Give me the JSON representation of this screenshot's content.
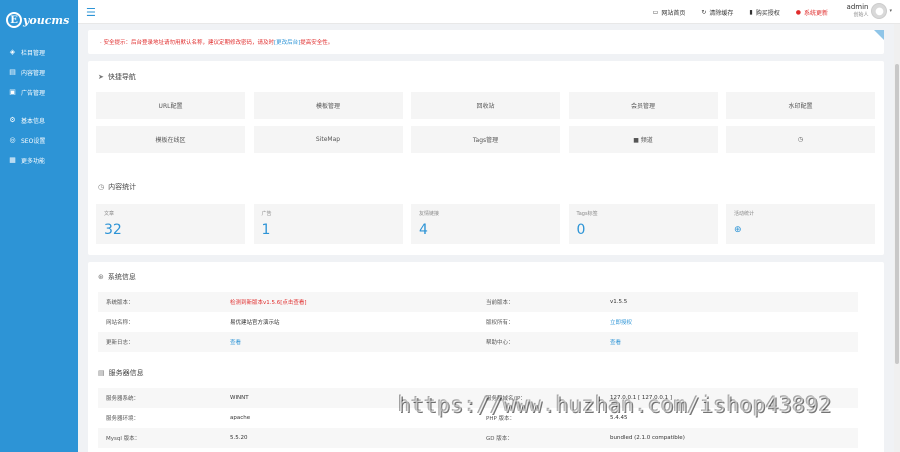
{
  "app": {
    "logo_letter": "E",
    "logo_text": "youcms"
  },
  "sidebar": {
    "items": [
      {
        "icon": "layers-icon",
        "glyph": "◈",
        "label": "栏目管理"
      },
      {
        "icon": "document-icon",
        "glyph": "▤",
        "label": "内容管理"
      },
      {
        "icon": "image-icon",
        "glyph": "▣",
        "label": "广告管理"
      },
      {
        "icon": "settings-icon",
        "glyph": "⚙",
        "label": "基本信息"
      },
      {
        "icon": "seo-icon",
        "glyph": "◎",
        "label": "SEO设置"
      },
      {
        "icon": "function-icon",
        "glyph": "▦",
        "label": "更多功能"
      }
    ]
  },
  "topbar": {
    "links": [
      {
        "glyph": "▭",
        "label": "网站首页"
      },
      {
        "glyph": "↻",
        "label": "清除缓存"
      },
      {
        "glyph": "▮",
        "label": "购买授权"
      },
      {
        "glyph": "●",
        "label": "系统更新"
      }
    ],
    "user": {
      "name": "admin",
      "role": "创始人",
      "caret": "▾"
    }
  },
  "alert": {
    "text": "· 安全提示：后台登录地址请勿用默认名称，建议定期修改密码，请及时",
    "link": "[更改后台]",
    "suffix": "提高安全性。"
  },
  "quick": {
    "title": "快捷导航",
    "icon_glyph": "➤",
    "items": [
      {
        "label": "URL配置"
      },
      {
        "label": "模板管理"
      },
      {
        "label": "回收站"
      },
      {
        "label": "会员管理"
      },
      {
        "label": "水印配置"
      },
      {
        "label": "模板在线区"
      },
      {
        "label": "SiteMap"
      },
      {
        "label": "Tags管理"
      },
      {
        "label": "■ 频道"
      },
      {
        "label": "◷"
      }
    ]
  },
  "stats": {
    "title": "内容统计",
    "icon_glyph": "◷",
    "items": [
      {
        "label": "文章",
        "value": "32"
      },
      {
        "label": "广告",
        "value": "1"
      },
      {
        "label": "友情链接",
        "value": "4"
      },
      {
        "label": "Tags标签",
        "value": "0"
      },
      {
        "label": "活动统计",
        "value": ""
      }
    ],
    "last_icon_glyph": "⊕"
  },
  "system": {
    "title": "系统信息",
    "icon_glyph": "⊛",
    "rows": [
      {
        "k1": "系统版本：",
        "v1": "检测到新版本v1.5.6[点击查看]",
        "k2": "当前版本：",
        "v2": "v1.5.5"
      },
      {
        "k1": "网站名称：",
        "v1": "易优建站官方演示站",
        "k2": "版权所有：",
        "v2": "立即授权"
      },
      {
        "k1": "更新日志：",
        "v1": "查看",
        "k2": "帮助中心：",
        "v2": "查看"
      }
    ]
  },
  "server": {
    "title": "服务器信息",
    "icon_glyph": "▤",
    "rows": [
      {
        "k1": "服务器系统：",
        "v1": "WINNT",
        "k2": "服务器域名/IP：",
        "v2": "127.0.0.1 [ 127.0.0.1 ]"
      },
      {
        "k1": "服务器环境：",
        "v1": "apache",
        "k2": "PHP 版本：",
        "v2": "5.4.45"
      },
      {
        "k1": "Mysql 版本：",
        "v1": "5.5.20",
        "k2": "GD 版本：",
        "v2": "bundled (2.1.0 compatible)"
      }
    ]
  },
  "watermark": "https://www.huzhan.com/ishop43892",
  "colors": {
    "accent": "#2d94d6",
    "danger": "#e02b2b",
    "background": "#f0f2f5"
  }
}
